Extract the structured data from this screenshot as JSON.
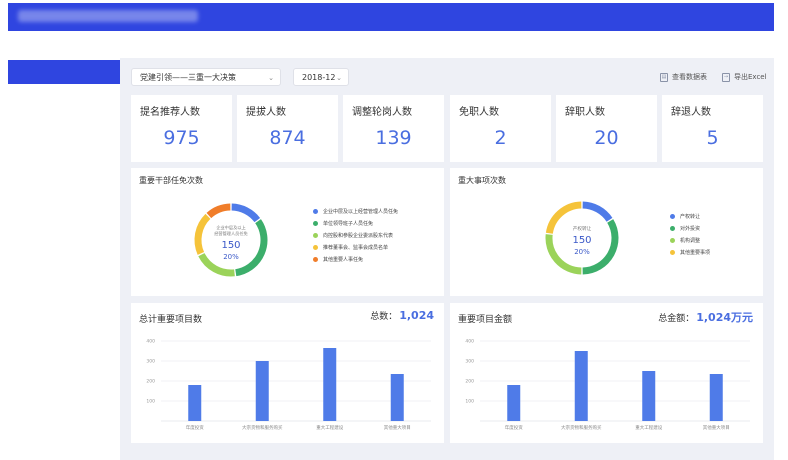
{
  "toolbar": {
    "category_select": "党建引领——三重一大决策",
    "date_select": "2018-12",
    "view_data_label": "查看数据表",
    "export_label": "导出Excel"
  },
  "stats": [
    {
      "label": "提名推荐人数",
      "value": "975"
    },
    {
      "label": "提拔人数",
      "value": "874"
    },
    {
      "label": "调整轮岗人数",
      "value": "139"
    },
    {
      "label": "免职人数",
      "value": "2"
    },
    {
      "label": "辞职人数",
      "value": "20"
    },
    {
      "label": "辞退人数",
      "value": "5"
    }
  ],
  "appointments_panel": {
    "title": "重要干部任免次数",
    "center_label": "企业中层及以上经营管理人员任免",
    "center_value": "150",
    "center_percent": "20%",
    "legend": [
      {
        "label": "企业中层及以上经营管理人员任免",
        "color": "#4f7be8"
      },
      {
        "label": "单位领导班子人员任免",
        "color": "#3cae6b"
      },
      {
        "label": "向控股和参股企业委派股东代表",
        "color": "#9bd35a"
      },
      {
        "label": "推荐董事会、监事会成员名单",
        "color": "#f5c33a"
      },
      {
        "label": "其他重要人事任免",
        "color": "#f07d2a"
      }
    ],
    "slices": [
      0.15,
      0.33,
      0.2,
      0.2,
      0.12
    ]
  },
  "matters_panel": {
    "title": "重大事项次数",
    "center_label": "产权转让",
    "center_value": "150",
    "center_percent": "20%",
    "legend": [
      {
        "label": "产权转让",
        "color": "#4f7be8"
      },
      {
        "label": "对外投资",
        "color": "#3cae6b"
      },
      {
        "label": "机构调整",
        "color": "#9bd35a"
      },
      {
        "label": "其他重要事项",
        "color": "#f5c33a"
      }
    ],
    "slices": [
      0.16,
      0.34,
      0.27,
      0.23
    ]
  },
  "projects_panel": {
    "title": "总计重要项目数",
    "total_label": "总数：",
    "total_value": "1,024"
  },
  "amount_panel": {
    "title": "重要项目金额",
    "total_label": "总金额：",
    "total_value": "1,024万元"
  },
  "chart_data": [
    {
      "type": "bar",
      "title": "总计重要项目数",
      "categories": [
        "年度投资",
        "大宗货物和服务购买",
        "重大工程建设",
        "其他重大项目"
      ],
      "values": [
        180,
        300,
        365,
        235
      ],
      "ylim": [
        0,
        400
      ],
      "yticks": [
        "100",
        "200",
        "300",
        "400"
      ],
      "grid": true
    },
    {
      "type": "bar",
      "title": "重要项目金额",
      "categories": [
        "年度投资",
        "大宗货物和服务购买",
        "重大工程建设",
        "其他重大项目"
      ],
      "values": [
        180,
        350,
        250,
        235
      ],
      "ylim": [
        0,
        400
      ],
      "yticks": [
        "100",
        "200",
        "300",
        "400"
      ],
      "grid": true
    }
  ]
}
